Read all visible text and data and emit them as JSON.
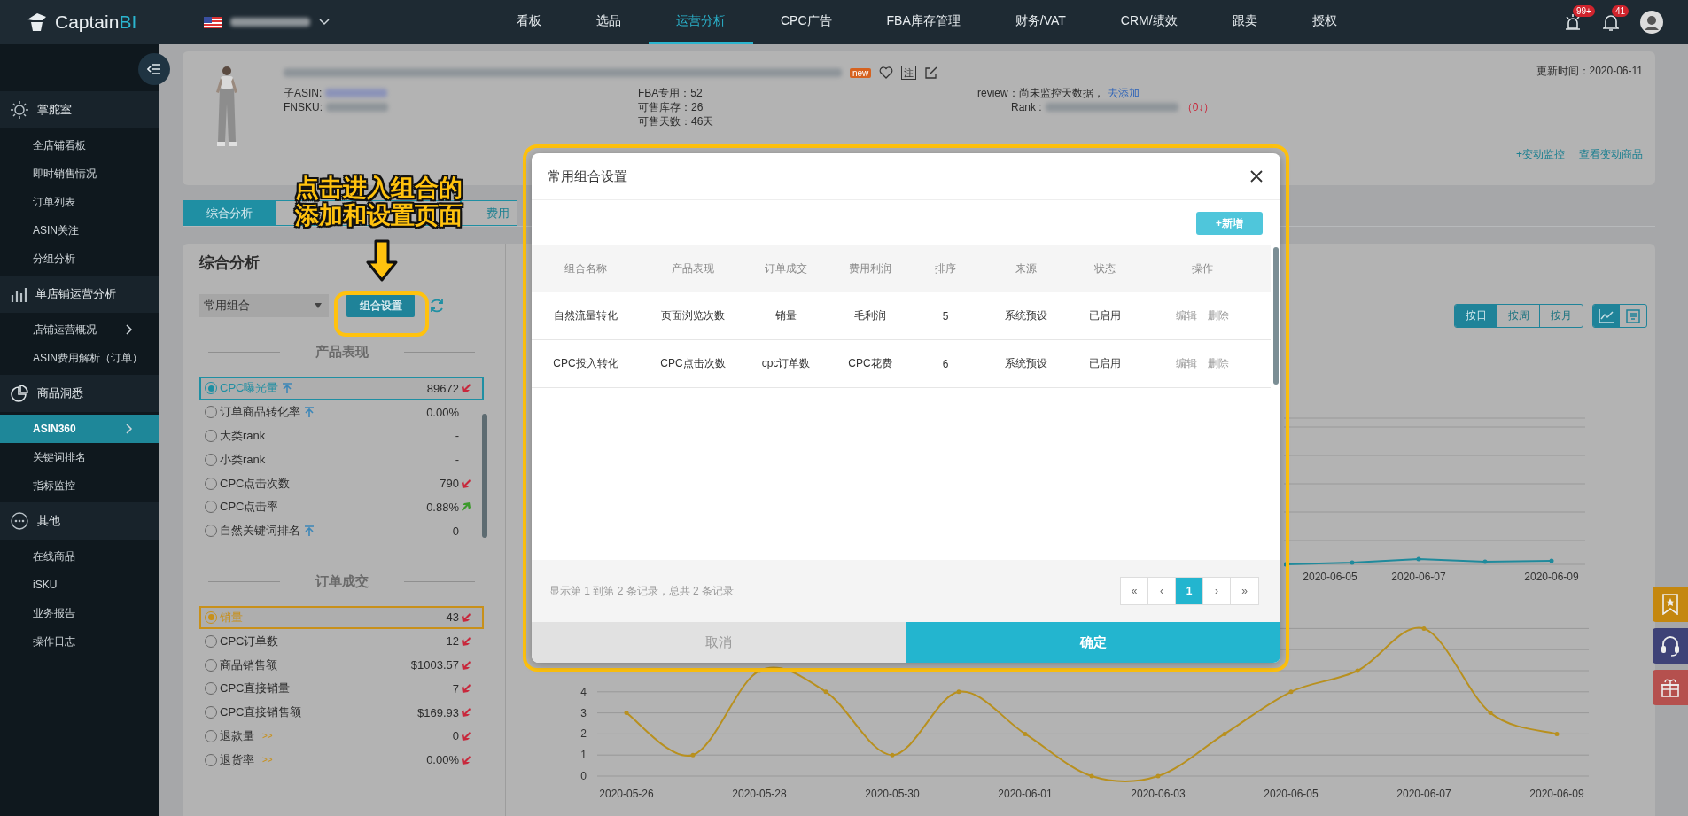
{
  "topbar": {
    "logo": "Captain",
    "logo_accent": "BI",
    "nav": [
      {
        "label": "看板",
        "selected": false
      },
      {
        "label": "选品",
        "selected": false
      },
      {
        "label": "运营分析",
        "selected": true
      },
      {
        "label": "CPC广告",
        "selected": false
      },
      {
        "label": "FBA库存管理",
        "selected": false
      },
      {
        "label": "财务/VAT",
        "selected": false
      },
      {
        "label": "CRM/绩效",
        "selected": false
      },
      {
        "label": "跟卖",
        "selected": false
      },
      {
        "label": "授权",
        "selected": false
      }
    ],
    "alerts": [
      {
        "kind": "alarm",
        "badge": "99+"
      },
      {
        "kind": "bell",
        "badge": "41"
      }
    ]
  },
  "sidebar": [
    {
      "title": "掌舵室",
      "items": [
        {
          "label": "全店铺看板",
          "selected": false,
          "expandable": false
        },
        {
          "label": "即时销售情况",
          "selected": false,
          "expandable": false
        },
        {
          "label": "订单列表",
          "selected": false,
          "expandable": false
        },
        {
          "label": "ASIN关注",
          "selected": false,
          "expandable": false
        },
        {
          "label": "分组分析",
          "selected": false,
          "expandable": false
        }
      ]
    },
    {
      "title": "单店铺运营分析",
      "items": [
        {
          "label": "店铺运营概况",
          "selected": false,
          "expandable": true
        },
        {
          "label": "ASIN费用解析（订单）",
          "selected": false,
          "expandable": false
        }
      ]
    },
    {
      "title": "商品洞悉",
      "items": [
        {
          "label": "ASIN360",
          "selected": true,
          "expandable": true
        },
        {
          "label": "关键词排名",
          "selected": false,
          "expandable": false
        },
        {
          "label": "指标监控",
          "selected": false,
          "expandable": false
        }
      ]
    },
    {
      "title": "其他",
      "items": [
        {
          "label": "在线商品",
          "selected": false,
          "expandable": false
        },
        {
          "label": "iSKU",
          "selected": false,
          "expandable": false
        },
        {
          "label": "业务报告",
          "selected": false,
          "expandable": false
        },
        {
          "label": "操作日志",
          "selected": false,
          "expandable": false
        }
      ]
    }
  ],
  "product": {
    "badge": "new",
    "note": "注",
    "sub_asin_label": "子ASIN:",
    "fnsku_label": "FNSKU:",
    "stats": [
      "FBA专用：52",
      "可售库存：26",
      "可售天数：46天"
    ],
    "review_label": "review：尚未监控天数据，",
    "review_link": "去添加",
    "rank_label": "Rank :",
    "rank_change": "（0↓）",
    "updated": "更新时间：2020-06-11",
    "links": [
      "+变动监控",
      "查看变动商品"
    ]
  },
  "tabs": [
    {
      "label": "综合分析",
      "selected": true
    },
    {
      "label": "费用",
      "selected": false
    }
  ],
  "panel": {
    "title": "综合分析",
    "select": "常用组合",
    "settings_button": "组合设置",
    "sections": [
      {
        "title": "产品表现",
        "color": "#1f8fa3",
        "scrollable": true,
        "metrics": [
          {
            "label": "CPC曝光量",
            "value": "89672",
            "up": false,
            "down": true,
            "pinned": true,
            "selected": true
          },
          {
            "label": "订单商品转化率",
            "value": "0.00%",
            "up": false,
            "down": false,
            "pinned": true,
            "selected": false
          },
          {
            "label": "大类rank",
            "value": "-",
            "up": false,
            "down": false,
            "pinned": false,
            "selected": false
          },
          {
            "label": "小类rank",
            "value": "-",
            "up": false,
            "down": false,
            "pinned": false,
            "selected": false
          },
          {
            "label": "CPC点击次数",
            "value": "790",
            "up": false,
            "down": true,
            "pinned": false,
            "selected": false
          },
          {
            "label": "CPC点击率",
            "value": "0.88%",
            "up": true,
            "down": false,
            "pinned": false,
            "selected": false
          },
          {
            "label": "自然关键词排名",
            "value": "0",
            "up": false,
            "down": false,
            "pinned": true,
            "selected": false
          }
        ]
      },
      {
        "title": "订单成交",
        "color": "#c8901a",
        "scrollable": false,
        "metrics": [
          {
            "label": "销量",
            "value": "43",
            "up": false,
            "down": true,
            "pinned": false,
            "selected": true
          },
          {
            "label": "CPC订单数",
            "value": "12",
            "up": false,
            "down": true,
            "pinned": false,
            "selected": false
          },
          {
            "label": "商品销售额",
            "value": "$1003.57",
            "up": false,
            "down": true,
            "pinned": false,
            "selected": false
          },
          {
            "label": "CPC直接销量",
            "value": "7",
            "up": false,
            "down": true,
            "pinned": false,
            "selected": false
          },
          {
            "label": "CPC直接销售额",
            "value": "$169.93",
            "up": false,
            "down": true,
            "pinned": false,
            "selected": false
          },
          {
            "label": "退款量",
            "value": "0",
            "up": false,
            "down": true,
            "pinned": false,
            "selected": false,
            "link": ">>"
          },
          {
            "label": "退货率",
            "value": "0.00%",
            "up": false,
            "down": true,
            "pinned": false,
            "selected": false,
            "link": ">>"
          }
        ]
      }
    ]
  },
  "granularity": [
    {
      "label": "按日",
      "selected": true
    },
    {
      "label": "按周",
      "selected": false
    },
    {
      "label": "按月",
      "selected": false
    }
  ],
  "view_modes": [
    {
      "kind": "chart",
      "selected": true
    },
    {
      "kind": "table",
      "selected": false
    }
  ],
  "trend_chart": {
    "x_labels": [
      "2020-06-05",
      "2020-06-07",
      "2020-06-09"
    ]
  },
  "sales_chart": {
    "chart_data": {
      "type": "line",
      "categories": [
        "2020-05-26",
        null,
        "2020-05-28",
        null,
        "2020-05-30",
        null,
        "2020-06-01",
        null,
        "2020-06-03",
        null,
        "2020-06-05",
        null,
        "2020-06-07",
        null,
        "2020-06-09"
      ],
      "series": [
        {
          "color": "#b8901f",
          "values": [
            3,
            1,
            5,
            4,
            1,
            4,
            2,
            0,
            0,
            2,
            4,
            5,
            7,
            3,
            2
          ]
        }
      ],
      "ylim": [
        0,
        7
      ],
      "yticks": [
        0,
        1,
        2,
        3,
        4
      ],
      "grid": true
    }
  },
  "dialog": {
    "title": "常用组合设置",
    "add_button": "+新增",
    "columns": [
      "组合名称",
      "产品表现",
      "订单成交",
      "费用利润",
      "排序",
      "来源",
      "状态",
      "操作"
    ],
    "rows": [
      {
        "cells": [
          "自然流量转化",
          "页面浏览次数",
          "销量",
          "毛利润",
          "5",
          "系统预设",
          "已启用"
        ],
        "actions": [
          "编辑",
          "删除"
        ]
      },
      {
        "cells": [
          "CPC投入转化",
          "CPC点击次数",
          "cpc订单数",
          "CPC花费",
          "6",
          "系统预设",
          "已启用"
        ],
        "actions": [
          "编辑",
          "删除"
        ]
      }
    ],
    "summary": "显示第 1 到第 2 条记录，总共 2 条记录",
    "pages": [
      {
        "label": "«",
        "selected": false
      },
      {
        "label": "‹",
        "selected": false
      },
      {
        "label": "1",
        "selected": true
      },
      {
        "label": "›",
        "selected": false
      },
      {
        "label": "»",
        "selected": false
      }
    ],
    "cancel": "取消",
    "confirm": "确定"
  },
  "annotation": {
    "lines": [
      "点击进入组合的",
      "添加和设置页面"
    ]
  },
  "floating_buttons": [
    {
      "kind": "bookmark",
      "color": "#c4870f"
    },
    {
      "kind": "headset",
      "color": "#3e4277"
    },
    {
      "kind": "gift",
      "color": "#b5504e"
    }
  ]
}
